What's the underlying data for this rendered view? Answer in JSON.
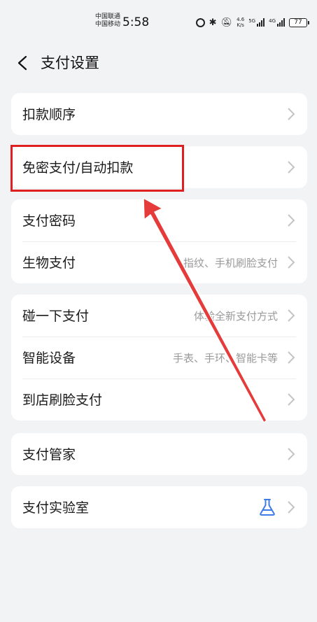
{
  "status_bar": {
    "carrier1": "中国联通",
    "carrier2": "中国移动",
    "time": "5:58",
    "net_speed_value": "4.6",
    "net_speed_unit": "K/s",
    "sim1_tag": "5G",
    "sim2_tag": "4G",
    "battery": "77"
  },
  "header": {
    "title": "支付设置"
  },
  "sections": [
    {
      "rows": [
        {
          "label": "扣款顺序",
          "value": ""
        }
      ]
    },
    {
      "rows": [
        {
          "label": "免密支付/自动扣款",
          "value": ""
        }
      ]
    },
    {
      "rows": [
        {
          "label": "支付密码",
          "value": ""
        },
        {
          "label": "生物支付",
          "value": "指纹、手机刷脸支付"
        }
      ]
    },
    {
      "rows": [
        {
          "label": "碰一下支付",
          "value": "体验全新支付方式"
        },
        {
          "label": "智能设备",
          "value": "手表、手环、智能卡等"
        },
        {
          "label": "到店刷脸支付",
          "value": ""
        }
      ]
    },
    {
      "rows": [
        {
          "label": "支付管家",
          "value": ""
        }
      ]
    },
    {
      "rows": [
        {
          "label": "支付实验室",
          "value": "",
          "icon": "flask-icon"
        }
      ]
    }
  ],
  "colors": {
    "accent": "#3d7be8",
    "annotation": "#e02020",
    "background": "#f2f3f5"
  }
}
